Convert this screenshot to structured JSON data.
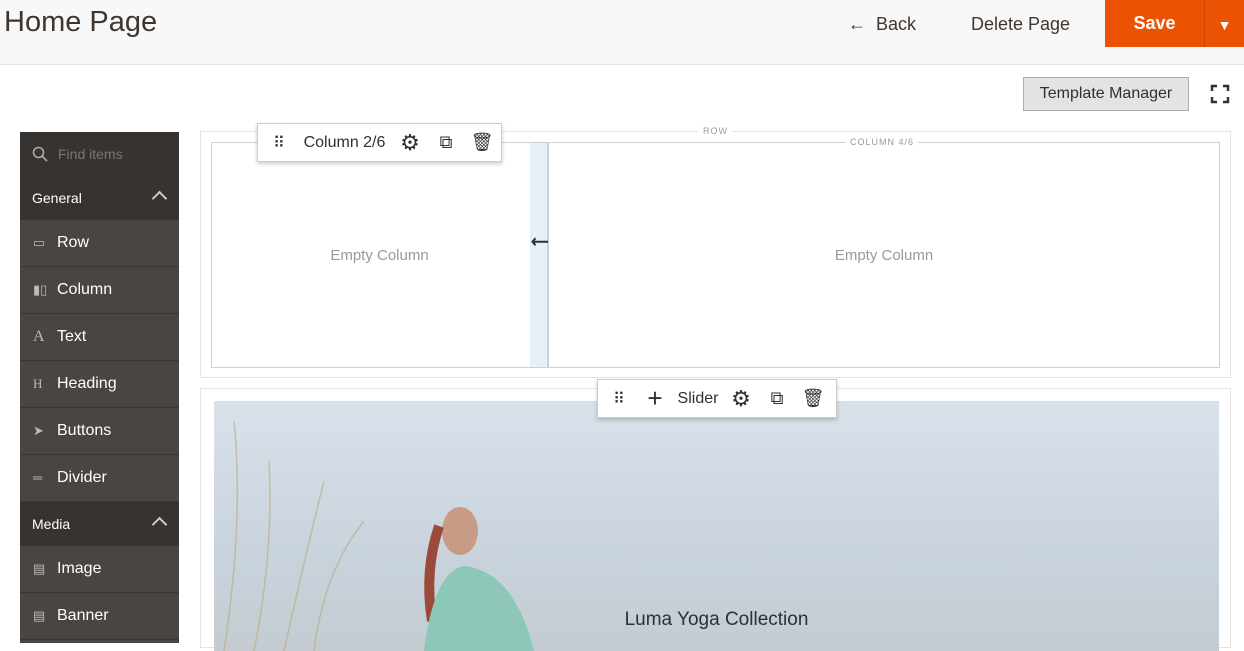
{
  "header": {
    "title": "Home Page",
    "back": "Back",
    "delete": "Delete Page",
    "save": "Save"
  },
  "toolbar": {
    "template_manager": "Template Manager"
  },
  "sidebar": {
    "search_placeholder": "Find items",
    "groups": [
      {
        "label": "General",
        "items": [
          {
            "label": "Row",
            "icon": "row-icon"
          },
          {
            "label": "Column",
            "icon": "column-icon"
          },
          {
            "label": "Text",
            "icon": "text-icon"
          },
          {
            "label": "Heading",
            "icon": "heading-icon"
          },
          {
            "label": "Buttons",
            "icon": "pointer-icon"
          },
          {
            "label": "Divider",
            "icon": "divider-icon"
          }
        ]
      },
      {
        "label": "Media",
        "items": [
          {
            "label": "Image",
            "icon": "image-icon"
          },
          {
            "label": "Banner",
            "icon": "banner-icon"
          }
        ]
      }
    ]
  },
  "stage": {
    "row_label": "ROW",
    "col1": {
      "toolbar_label": "Column 2/6",
      "empty": "Empty Column"
    },
    "col2": {
      "label": "COLUMN 4/6",
      "empty": "Empty Column"
    },
    "slider": {
      "toolbar_label": "Slider",
      "title": "Luma Yoga Collection"
    }
  },
  "colors": {
    "accent": "#eb5202",
    "sidebar": "#4a4542",
    "sidebar_header": "#373330"
  }
}
